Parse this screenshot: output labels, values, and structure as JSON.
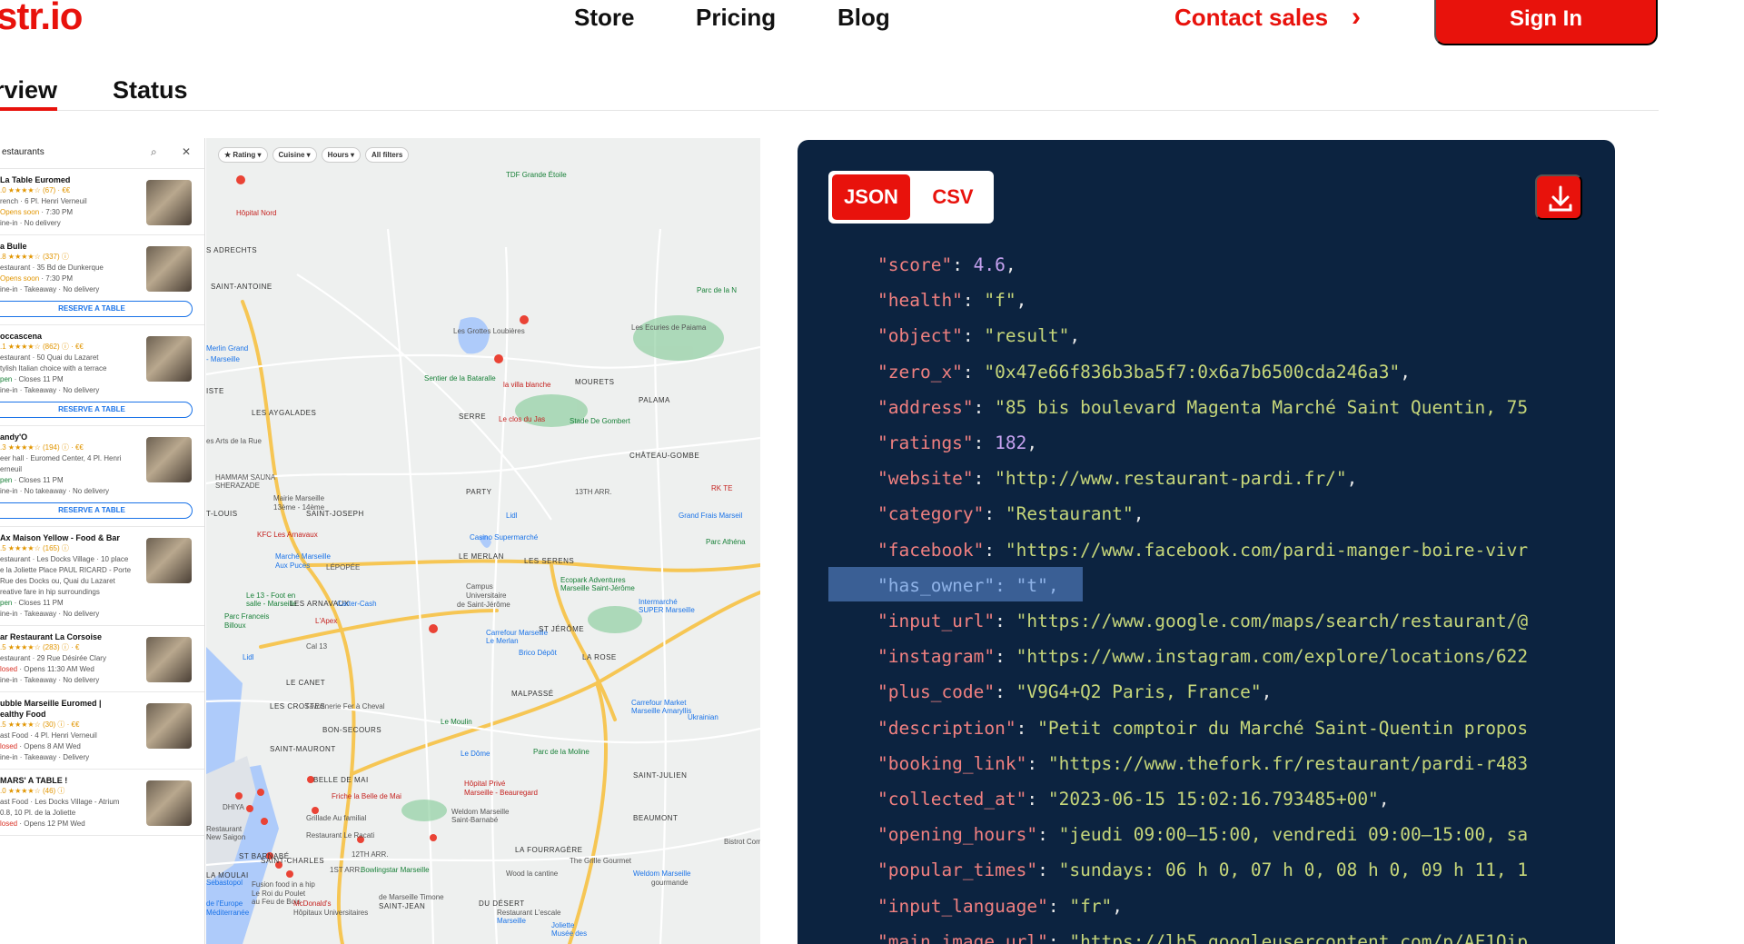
{
  "nav": {
    "logo": "str.io",
    "store": "Store",
    "pricing": "Pricing",
    "blog": "Blog",
    "contact": "Contact sales",
    "chevron": "›",
    "signin": "Sign In"
  },
  "tabs": {
    "overview": "rview",
    "status": "Status"
  },
  "maps": {
    "search": "estaurants",
    "filters": [
      "★ Rating ▾",
      "Cuisine ▾",
      "Hours ▾",
      "All filters"
    ],
    "results": [
      {
        "name": "La Table Euromed",
        "rating": ".0 ★★★★☆ (67) · €€",
        "type": "rench · 6 Pl. Henri Verneuil",
        "status": "Opens soon",
        "hours": "· 7:30 PM",
        "svc": "ine-in · No delivery",
        "reserve": ""
      },
      {
        "name": "a Bulle",
        "rating": ".8 ★★★★☆ (337) ⓘ",
        "type": "estaurant · 35 Bd de Dunkerque",
        "status": "Opens soon",
        "hours": "· 7:30 PM",
        "svc": "ine-in · Takeaway · No delivery",
        "reserve": "RESERVE A TABLE"
      },
      {
        "name": "occascena",
        "rating": ".1 ★★★★☆ (862) ⓘ · €€",
        "type": "estaurant · 50 Quai du Lazaret",
        "extra": "tylish Italian choice with a terrace",
        "status": "pen",
        "hours": "· Closes 11 PM",
        "svc": "ine-in · Takeaway · No delivery",
        "reserve": "RESERVE A TABLE"
      },
      {
        "name": "andy'O",
        "rating": ".3 ★★★★☆ (194) ⓘ · €€",
        "type": "eer hall · Euromed Center, 4 Pl. Henri",
        "extra": "erneuil",
        "status": "pen",
        "hours": "· Closes 11 PM",
        "svc": "ine-in · No takeaway · No delivery",
        "reserve": "RESERVE A TABLE"
      },
      {
        "name": "Ax Maison Yellow - Food & Bar",
        "rating": ".5 ★★★★☆ (165) ⓘ",
        "type": "estaurant · Les Docks Village · 10 place",
        "extra": "e la Joliette Place PAUL RICARD - Porte",
        "extra2": "Rue des Docks ou, Quai du Lazaret",
        "extra3": "reative fare in hip surroundings",
        "status": "pen",
        "hours": "· Closes 11 PM",
        "svc": "ine-in · Takeaway · No delivery",
        "reserve": ""
      },
      {
        "name": "ar Restaurant La Corsoise",
        "rating": ".5 ★★★★☆ (283) ⓘ · €",
        "type": "estaurant · 29 Rue Désirée Clary",
        "status": "losed",
        "hours": "· Opens 11:30 AM Wed",
        "svc": "ine-in · Takeaway · No delivery",
        "reserve": ""
      },
      {
        "name": "ubble Marseille Euromed |",
        "name2": "ealthy Food",
        "rating": ".5 ★★★★☆ (30) ⓘ · €€",
        "type": "ast Food · 4 Pl. Henri Verneuil",
        "status": "losed",
        "hours": "· Opens 8 AM Wed",
        "svc": "ine-in · Takeaway · Delivery",
        "reserve": ""
      },
      {
        "name": "MARS' A TABLE !",
        "rating": ".0 ★★★★☆ (46) ⓘ",
        "type": "ast Food · Les Docks Village - Atrium",
        "extra": "0.8, 10 Pl. de la Joliette",
        "status": "losed",
        "hours": "· Opens 12 PM Wed",
        "svc": "",
        "reserve": ""
      }
    ],
    "labels": [
      {
        "t": "Hôpital Nord",
        "c": "r"
      },
      {
        "t": "TDF Grande Étoile",
        "c": "g"
      },
      {
        "t": "S ADRECHTS",
        "c": "k"
      },
      {
        "t": "SAINT-ANTOINE",
        "c": "k"
      },
      {
        "t": "Parc de la N",
        "c": "g"
      },
      {
        "t": "Les Grottes Loubières",
        "c": ""
      },
      {
        "t": "Les Ecuries de Paiama",
        "c": ""
      },
      {
        "t": "Merlin Grand",
        "c": "b"
      },
      {
        "t": "- Marseille",
        "c": "b"
      },
      {
        "t": "Sentier de la Bataralle",
        "c": "g"
      },
      {
        "t": "la villa blanche",
        "c": "r"
      },
      {
        "t": "MOURETS",
        "c": "k"
      },
      {
        "t": "PALAMA",
        "c": "k"
      },
      {
        "t": "ISTE",
        "c": "k"
      },
      {
        "t": "LES AYGALADES",
        "c": "k"
      },
      {
        "t": "Le clos du Jas",
        "c": "r"
      },
      {
        "t": "SERRE",
        "c": "k"
      },
      {
        "t": "Stade De Gombert",
        "c": "g"
      },
      {
        "t": "es Arts de la Rue",
        "c": ""
      },
      {
        "t": "CHÂTEAU-GOMBE",
        "c": "k"
      },
      {
        "t": "HAMMAM SAUNA",
        "c": ""
      },
      {
        "t": "SHERAZADE",
        "c": ""
      },
      {
        "t": "PARTY",
        "c": "k"
      },
      {
        "t": "13TH ARR.",
        "c": ""
      },
      {
        "t": "Mairie Marseille",
        "c": ""
      },
      {
        "t": "13ème - 14ème",
        "c": ""
      },
      {
        "t": "RK TE",
        "c": "r"
      },
      {
        "t": "T-LOUIS",
        "c": "k"
      },
      {
        "t": "SAINT-JOSEPH",
        "c": "k"
      },
      {
        "t": "Lidl",
        "c": "b"
      },
      {
        "t": "Grand Frais Marseil",
        "c": "b"
      },
      {
        "t": "KFC Les Arnavaux",
        "c": "r"
      },
      {
        "t": "Casino Supermarché",
        "c": "b"
      },
      {
        "t": "Parc Athéna",
        "c": "g"
      },
      {
        "t": "Marché Marseille",
        "c": "b"
      },
      {
        "t": "Aux Puces",
        "c": "b"
      },
      {
        "t": "LÉPOPÉE",
        "c": ""
      },
      {
        "t": "LE MERLAN",
        "c": "k"
      },
      {
        "t": "LES SERENS",
        "c": "k"
      },
      {
        "t": "Ecopark Adventures",
        "c": "g"
      },
      {
        "t": "Marseille Saint-Jérôme",
        "c": "g"
      },
      {
        "t": "Le 13 - Foot en",
        "c": "g"
      },
      {
        "t": "salle - Marseille",
        "c": "g"
      },
      {
        "t": "LES ARNAVAUX",
        "c": "k"
      },
      {
        "t": "Carter-Cash",
        "c": "b"
      },
      {
        "t": "Campus",
        "c": ""
      },
      {
        "t": "Universitaire",
        "c": ""
      },
      {
        "t": "de Saint-Jérôme",
        "c": ""
      },
      {
        "t": "Intermarché",
        "c": "b"
      },
      {
        "t": "SUPER Marseille",
        "c": "b"
      },
      {
        "t": "Parc Franceis",
        "c": "g"
      },
      {
        "t": "Billoux",
        "c": "g"
      },
      {
        "t": "L'Apex",
        "c": "r"
      },
      {
        "t": "Carrefour Marseille",
        "c": "b"
      },
      {
        "t": "Le Merlan",
        "c": "b"
      },
      {
        "t": "ST JÉRÔME",
        "c": "k"
      },
      {
        "t": "Cal 13",
        "c": ""
      },
      {
        "t": "Brico Dépôt",
        "c": "b"
      },
      {
        "t": "LA ROSE",
        "c": "k"
      },
      {
        "t": "Lidl",
        "c": "b"
      },
      {
        "t": "LE CANET",
        "c": "k"
      },
      {
        "t": "MALPASSÉ",
        "c": "k"
      },
      {
        "t": "LES CROTTES",
        "c": "k"
      },
      {
        "t": "Savonnerie Fer à Cheval",
        "c": ""
      },
      {
        "t": "BON-SECOURS",
        "c": "k"
      },
      {
        "t": "Le Moulin",
        "c": "g"
      },
      {
        "t": "Carrefour Market",
        "c": "b"
      },
      {
        "t": "Marseille Amaryllis",
        "c": "b"
      },
      {
        "t": "Ukrainian",
        "c": "b"
      },
      {
        "t": "SAINT-MAURONT",
        "c": "k"
      },
      {
        "t": "Le Dôme",
        "c": "b"
      },
      {
        "t": "Parc de la Moline",
        "c": "g"
      },
      {
        "t": "SAINT-JULIEN",
        "c": "k"
      },
      {
        "t": "Hôpital Privé",
        "c": "r"
      },
      {
        "t": "Marseille - Beauregard",
        "c": "r"
      },
      {
        "t": "BELLE DE MAI",
        "c": "k"
      },
      {
        "t": "Friche la Belle de Mai",
        "c": "r"
      },
      {
        "t": "DHIYA",
        "c": ""
      },
      {
        "t": "Grillade Au familial",
        "c": ""
      },
      {
        "t": "Weldom Marseille",
        "c": ""
      },
      {
        "t": "Saint-Barnabé",
        "c": ""
      },
      {
        "t": "BEAUMONT",
        "c": "k"
      },
      {
        "t": "Restaurant",
        "c": ""
      },
      {
        "t": "New Saigon",
        "c": ""
      },
      {
        "t": "Restaurant Le Racati",
        "c": ""
      },
      {
        "t": "SAINT-CHARLES",
        "c": "k"
      },
      {
        "t": "ST BARNABÉ",
        "c": "k"
      },
      {
        "t": "12TH ARR.",
        "c": ""
      },
      {
        "t": "LA FOURRAGÈRE",
        "c": "k"
      },
      {
        "t": "Bistrot Comptoir Ella",
        "c": ""
      },
      {
        "t": "The Grille Gourmet",
        "c": ""
      },
      {
        "t": "1ST ARR.",
        "c": ""
      },
      {
        "t": "LA MOULAI",
        "c": "k"
      },
      {
        "t": "Weldom Marseille",
        "c": "b"
      },
      {
        "t": "Sebastopol",
        "c": "b"
      },
      {
        "t": "Bowlingstar Marseille",
        "c": "g"
      },
      {
        "t": "Wood la cantine",
        "c": ""
      },
      {
        "t": "gourmande",
        "c": ""
      },
      {
        "t": "Fusion food in a hip",
        "c": ""
      },
      {
        "t": "Le Roi du Poulet",
        "c": ""
      },
      {
        "t": "au Feu de Bois",
        "c": ""
      },
      {
        "t": "McDonald's",
        "c": "r"
      },
      {
        "t": "Hôpitaux Universitaires",
        "c": ""
      },
      {
        "t": "de Marseille Timone",
        "c": ""
      },
      {
        "t": "SAINT-JEAN",
        "c": "k"
      },
      {
        "t": "DU DÉSERT",
        "c": "k"
      },
      {
        "t": "Restaurant L'escale",
        "c": ""
      },
      {
        "t": "Marseille",
        "c": "b"
      },
      {
        "t": "Joliette",
        "c": "b"
      },
      {
        "t": "Musée des",
        "c": "b"
      },
      {
        "t": "de l'Europe",
        "c": "b"
      },
      {
        "t": "Méditerranée",
        "c": "b"
      }
    ]
  },
  "exporter": {
    "json": "JSON",
    "csv": "CSV",
    "download_icon": "download-icon",
    "lines": [
      {
        "k": "\"score\"",
        "v": "4.6",
        "num": true
      },
      {
        "k": "\"health\"",
        "v": "\"f\""
      },
      {
        "k": "\"object\"",
        "v": "\"result\""
      },
      {
        "k": "\"zero_x\"",
        "v": "\"0x47e66f836b3ba5f7:0x6a7b6500cda246a3\""
      },
      {
        "k": "\"address\"",
        "v": "\"85 bis boulevard Magenta Marché Saint Quentin, 75"
      },
      {
        "k": "\"ratings\"",
        "v": "182",
        "num": true
      },
      {
        "k": "\"website\"",
        "v": "\"http://www.restaurant-pardi.fr/\""
      },
      {
        "k": "\"category\"",
        "v": "\"Restaurant\""
      },
      {
        "k": "\"facebook\"",
        "v": "\"https://www.facebook.com/pardi-manger-boire-vivr"
      },
      {
        "k": "\"has_owner\"",
        "v": "\"t\"",
        "sel": true
      },
      {
        "k": "\"input_url\"",
        "v": "\"https://www.google.com/maps/search/restaurant/@"
      },
      {
        "k": "\"instagram\"",
        "v": "\"https://www.instagram.com/explore/locations/622"
      },
      {
        "k": "\"plus_code\"",
        "v": "\"V9G4+Q2 Paris, France\""
      },
      {
        "k": "\"description\"",
        "v": "\"Petit comptoir du Marché Saint-Quentin propos"
      },
      {
        "k": "\"booking_link\"",
        "v": "\"https://www.thefork.fr/restaurant/pardi-r483"
      },
      {
        "k": "\"collected_at\"",
        "v": "\"2023-06-15 15:02:16.793485+00\""
      },
      {
        "k": "\"opening_hours\"",
        "v": "\"jeudi 09:00–15:00, vendredi 09:00–15:00, sa"
      },
      {
        "k": "\"popular_times\"",
        "v": "\"sundays: 06 h 0, 07 h 0, 08 h 0, 09 h 11, 1"
      },
      {
        "k": "\"input_language\"",
        "v": "\"fr\""
      },
      {
        "k": "\"main_image_url\"",
        "v": "\"https://lh5.googleusercontent.com/p/AF1Qip"
      }
    ]
  }
}
